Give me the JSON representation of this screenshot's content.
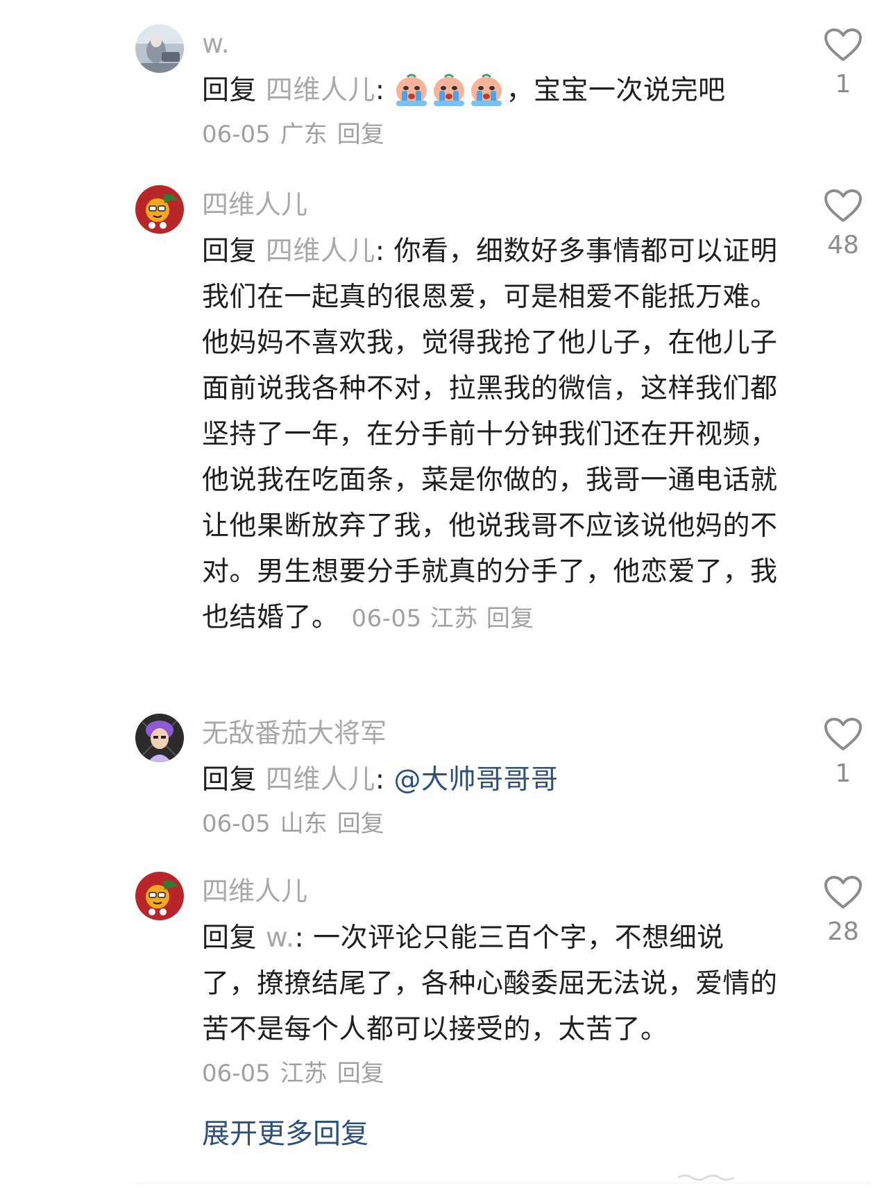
{
  "comments": [
    {
      "username": "w.",
      "reply_prefix": "回复 ",
      "reply_target": "四维人儿",
      "reply_sep": ": ",
      "text": "，宝宝一次说完吧",
      "emoji": [
        "crying-emoji",
        "crying-emoji",
        "crying-emoji"
      ],
      "date": "06-05",
      "location": "广东",
      "reply_label": "回复",
      "likes": "1"
    },
    {
      "username": "四维人儿",
      "reply_prefix": "回复 ",
      "reply_target": "四维人儿",
      "reply_sep": ": ",
      "text": "你看，细数好多事情都可以证明我们在一起真的很恩爱，可是相爱不能抵万难。他妈妈不喜欢我，觉得我抢了他儿子，在他儿子面前说我各种不对，拉黑我的微信，这样我们都坚持了一年，在分手前十分钟我们还在开视频，他说我在吃面条，菜是你做的，我哥一通电话就让他果断放弃了我，他说我哥不应该说他妈的不对。男生想要分手就真的分手了，他恋爱了，我也结婚了。",
      "date": "06-05",
      "location": "江苏",
      "reply_label": "回复",
      "likes": "48"
    },
    {
      "username": "无敌番茄大将军",
      "reply_prefix": "回复 ",
      "reply_target": "四维人儿",
      "reply_sep": ": ",
      "mention": "@大帅哥哥哥",
      "date": "06-05",
      "location": "山东",
      "reply_label": "回复",
      "likes": "1"
    },
    {
      "username": "四维人儿",
      "reply_prefix": "回复 ",
      "reply_target": "w.",
      "reply_sep": ": ",
      "text": "一次评论只能三百个字，不想细说了，撩撩结尾了，各种心酸委屈无法说，爱情的苦不是每个人都可以接受的，太苦了。",
      "date": "06-05",
      "location": "江苏",
      "reply_label": "回复",
      "likes": "28"
    }
  ],
  "expand_label": "展开更多回复",
  "colors": {
    "text": "#1e1e1e",
    "muted": "#a8a8a8",
    "link": "#2d4f7c",
    "heart_stroke": "#8c8c8c"
  }
}
